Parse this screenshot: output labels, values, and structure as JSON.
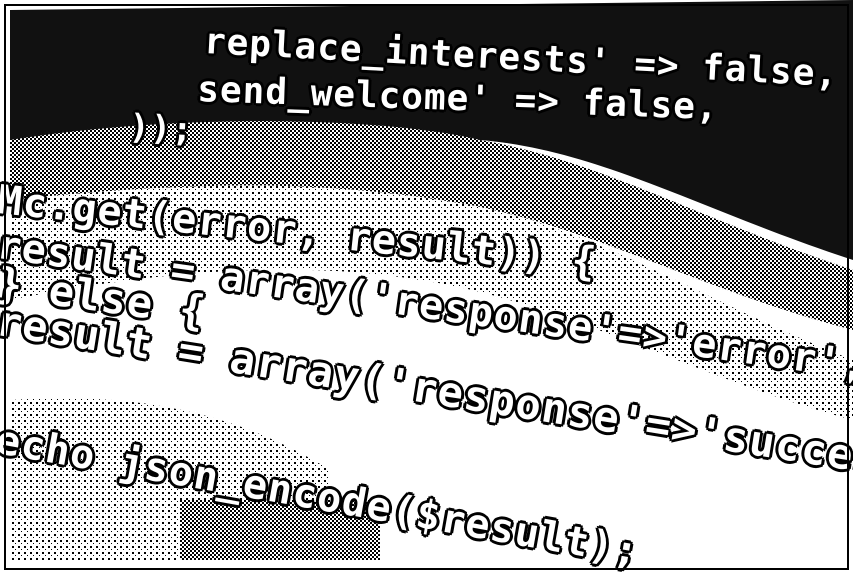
{
  "photo": {
    "subject": "dithered-code-photo",
    "colors": {
      "ink": "#000000",
      "paper": "#ffffff"
    },
    "code_lines": [
      "replace_interests' => false,",
      "send_welcome'       => false,",
      "));",
      "Mc.get(error, result)) {",
      "result = array('response'=>'error', 'message'",
      "} else {",
      "result = array('response'=>'success');",
      "echo json_encode($result);"
    ]
  }
}
